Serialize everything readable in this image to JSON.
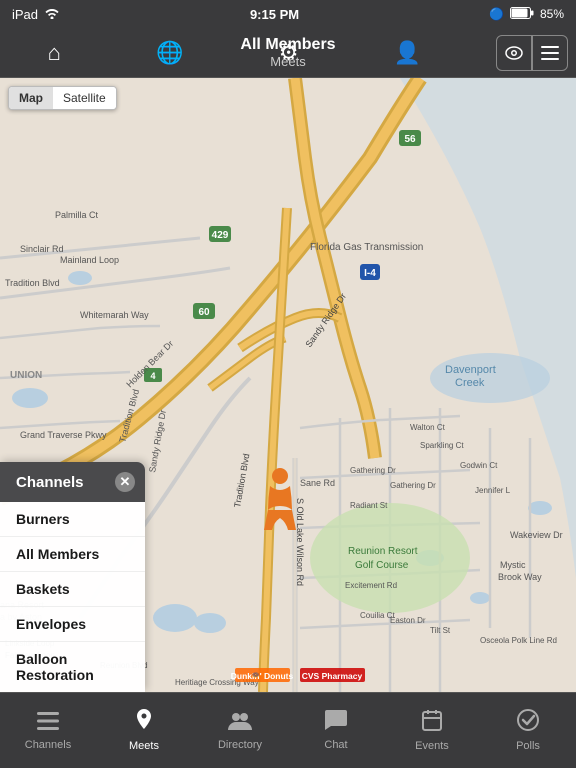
{
  "statusBar": {
    "left": "iPad",
    "time": "9:15 PM",
    "battery": "85%",
    "wifiIcon": "wifi",
    "bluetoothIcon": "bt"
  },
  "topNav": {
    "icons": [
      "home",
      "globe",
      "settings",
      "person",
      "help"
    ],
    "titleMain": "All Members",
    "titleSub": "Meets"
  },
  "mapToggle": {
    "mapLabel": "Map",
    "satelliteLabel": "Satellite"
  },
  "channelsPanel": {
    "header": "Channels",
    "items": [
      "Burners",
      "All Members",
      "Baskets",
      "Envelopes",
      "Balloon Restoration"
    ]
  },
  "bottomTabs": [
    {
      "label": "Channels",
      "icon": "☰",
      "active": false
    },
    {
      "label": "Meets",
      "icon": "📍",
      "active": true
    },
    {
      "label": "Directory",
      "icon": "👥",
      "active": false
    },
    {
      "label": "Chat",
      "icon": "💬",
      "active": false
    },
    {
      "label": "Events",
      "icon": "📅",
      "active": false
    },
    {
      "label": "Polls",
      "icon": "✓",
      "active": false
    }
  ]
}
